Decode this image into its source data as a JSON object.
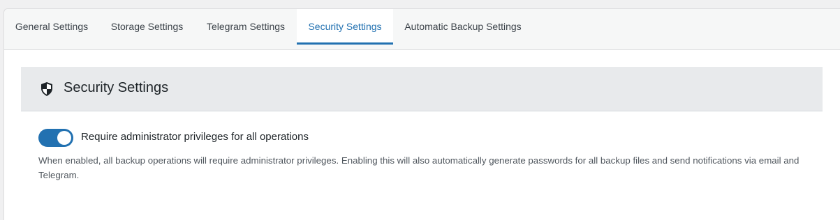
{
  "tabs": [
    {
      "label": "General Settings",
      "active": false
    },
    {
      "label": "Storage Settings",
      "active": false
    },
    {
      "label": "Telegram Settings",
      "active": false
    },
    {
      "label": "Security Settings",
      "active": true
    },
    {
      "label": "Automatic Backup Settings",
      "active": false
    }
  ],
  "section": {
    "icon": "shield-icon",
    "title": "Security Settings"
  },
  "setting": {
    "toggle_state": "on",
    "label": "Require administrator privileges for all operations",
    "description": "When enabled, all backup operations will require administrator privileges. Enabling this will also automatically generate passwords for all backup files and send notifications via email and Telegram."
  },
  "colors": {
    "accent": "#2271b1",
    "header_bg": "#e8eaec",
    "tabbar_bg": "#f6f7f7"
  }
}
